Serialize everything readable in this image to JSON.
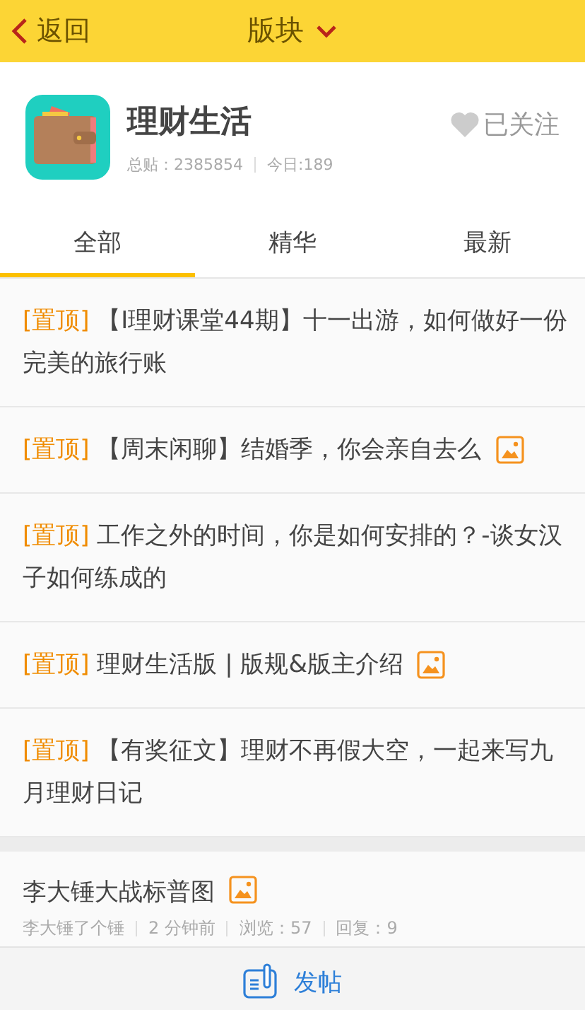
{
  "header": {
    "back": "返回",
    "title": "版块"
  },
  "forum": {
    "name": "理财生活",
    "followed": true,
    "follow_label": "已关注",
    "total_label": "总贴：",
    "total": "2385854",
    "today": "今日:189"
  },
  "tabs": [
    {
      "label": "全部",
      "selected": true
    },
    {
      "label": "精华",
      "selected": false
    },
    {
      "label": "最新",
      "selected": false
    }
  ],
  "pinned_posts": [
    {
      "tag": "[置顶]",
      "title": "【I理财课堂44期】十一出游，如何做好一份完美的旅行账",
      "has_image": false
    },
    {
      "tag": "[置顶]",
      "title": "【周末闲聊】结婚季，你会亲自去么",
      "has_image": true
    },
    {
      "tag": "[置顶]",
      "title": "工作之外的时间，你是如何安排的？-谈女汉子如何练成的",
      "has_image": false
    },
    {
      "tag": "[置顶]",
      "title": "理财生活版 | 版规&版主介绍",
      "has_image": true
    },
    {
      "tag": "[置顶]",
      "title": "【有奖征文】理财不再假大空，一起来写九月理财日记",
      "has_image": false
    }
  ],
  "posts": [
    {
      "title": "李大锤大战标普图",
      "has_image": true,
      "author": "李大锤了个锤",
      "time": "2 分钟前",
      "views": "浏览：57",
      "replies": "回复：9"
    }
  ],
  "bottom_bar": {
    "post_button": "发帖"
  }
}
